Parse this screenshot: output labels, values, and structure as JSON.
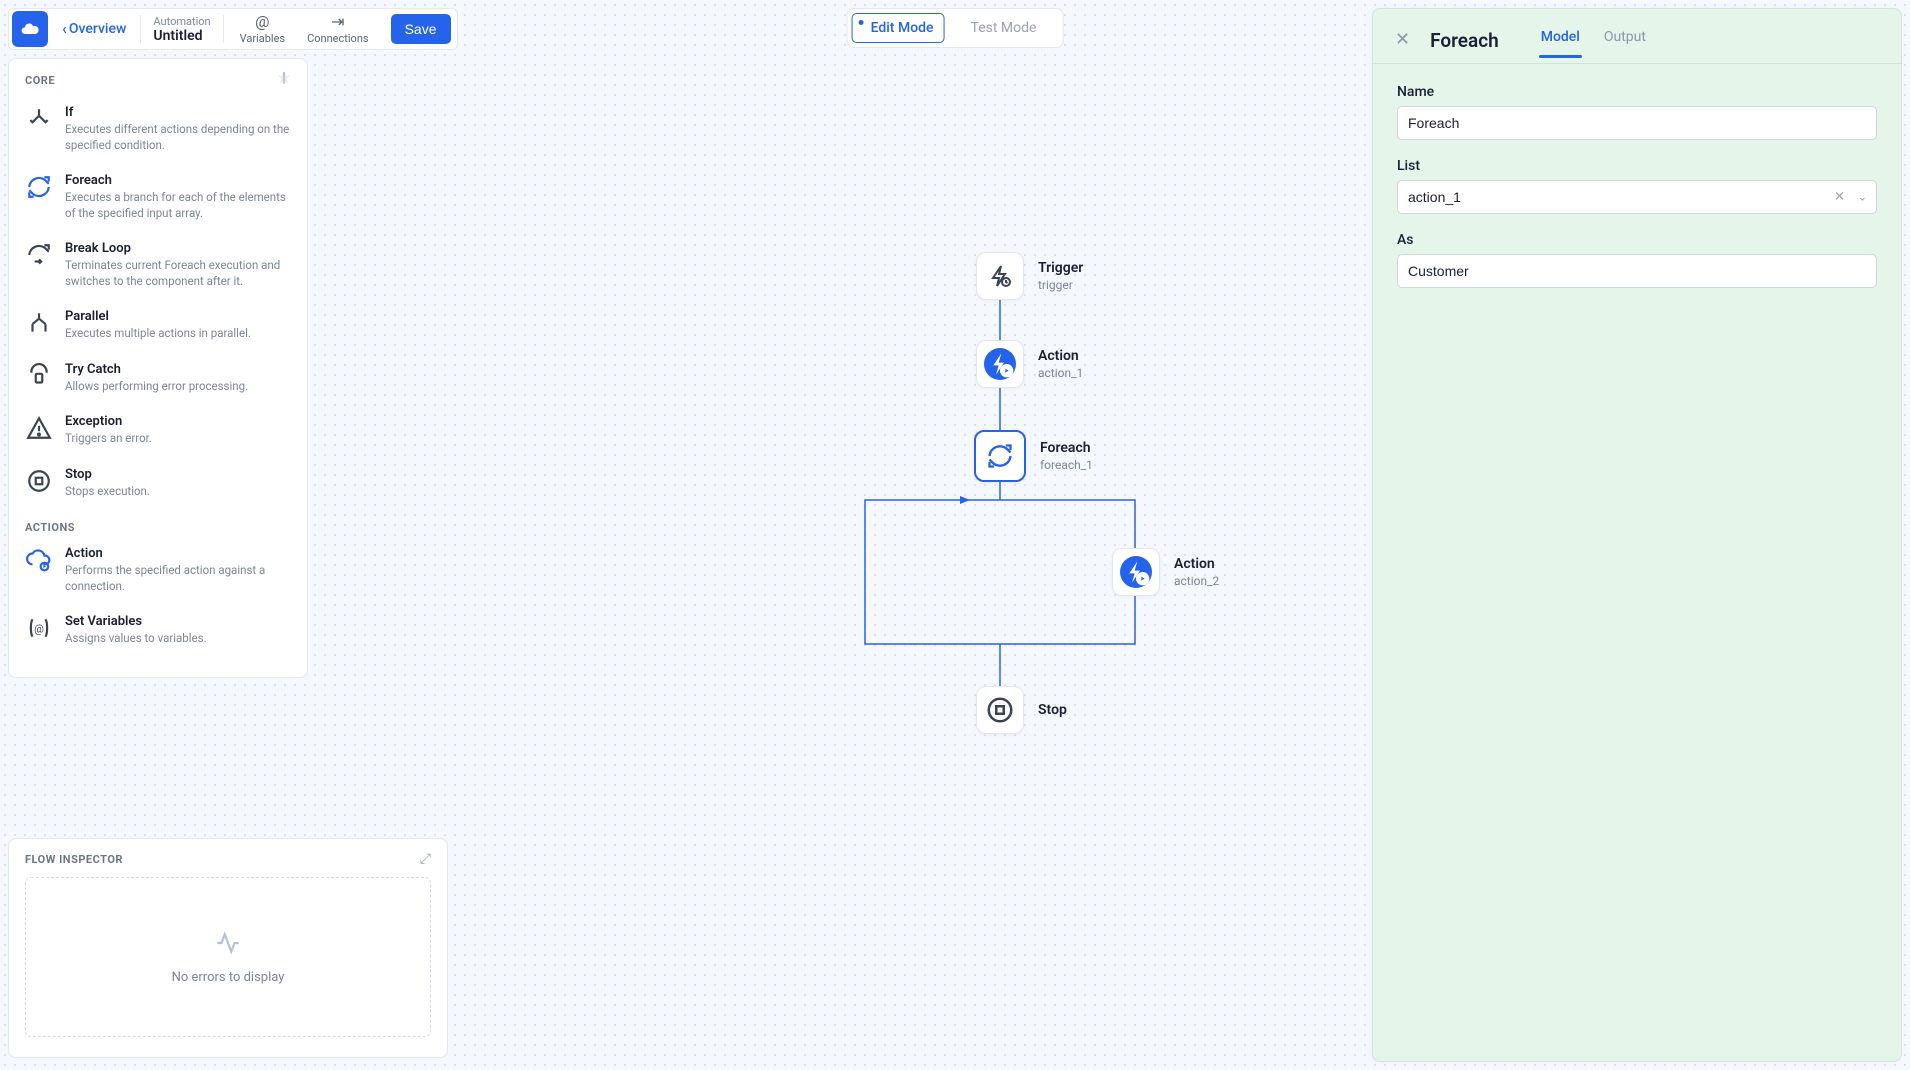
{
  "topbar": {
    "overview": "Overview",
    "automation_label": "Automation",
    "automation_name": "Untitled",
    "variables": "Variables",
    "connections": "Connections",
    "save": "Save"
  },
  "mode": {
    "edit": "Edit Mode",
    "test": "Test Mode"
  },
  "palette": {
    "core_label": "CORE",
    "actions_label": "ACTIONS",
    "items_core": [
      {
        "title": "If",
        "desc": "Executes different actions depending on the specified condition."
      },
      {
        "title": "Foreach",
        "desc": "Executes a branch for each of the elements of the specified input array."
      },
      {
        "title": "Break Loop",
        "desc": "Terminates current Foreach execution and switches to the component after it."
      },
      {
        "title": "Parallel",
        "desc": "Executes multiple actions in parallel."
      },
      {
        "title": "Try Catch",
        "desc": "Allows performing error processing."
      },
      {
        "title": "Exception",
        "desc": "Triggers an error."
      },
      {
        "title": "Stop",
        "desc": "Stops execution."
      }
    ],
    "items_actions": [
      {
        "title": "Action",
        "desc": "Performs the specified action against a connection."
      },
      {
        "title": "Set Variables",
        "desc": "Assigns values to variables."
      }
    ]
  },
  "inspector": {
    "label": "FLOW INSPECTOR",
    "empty": "No errors to display"
  },
  "right": {
    "title": "Foreach",
    "tab_model": "Model",
    "tab_output": "Output",
    "field_name_label": "Name",
    "field_name_value": "Foreach",
    "field_list_label": "List",
    "field_list_value": "action_1",
    "field_as_label": "As",
    "field_as_value": "Customer"
  },
  "nodes": {
    "trigger": {
      "title": "Trigger",
      "id": "trigger"
    },
    "action1": {
      "title": "Action",
      "id": "action_1"
    },
    "foreach": {
      "title": "Foreach",
      "id": "foreach_1"
    },
    "action2": {
      "title": "Action",
      "id": "action_2"
    },
    "stop": {
      "title": "Stop",
      "id": ""
    }
  }
}
